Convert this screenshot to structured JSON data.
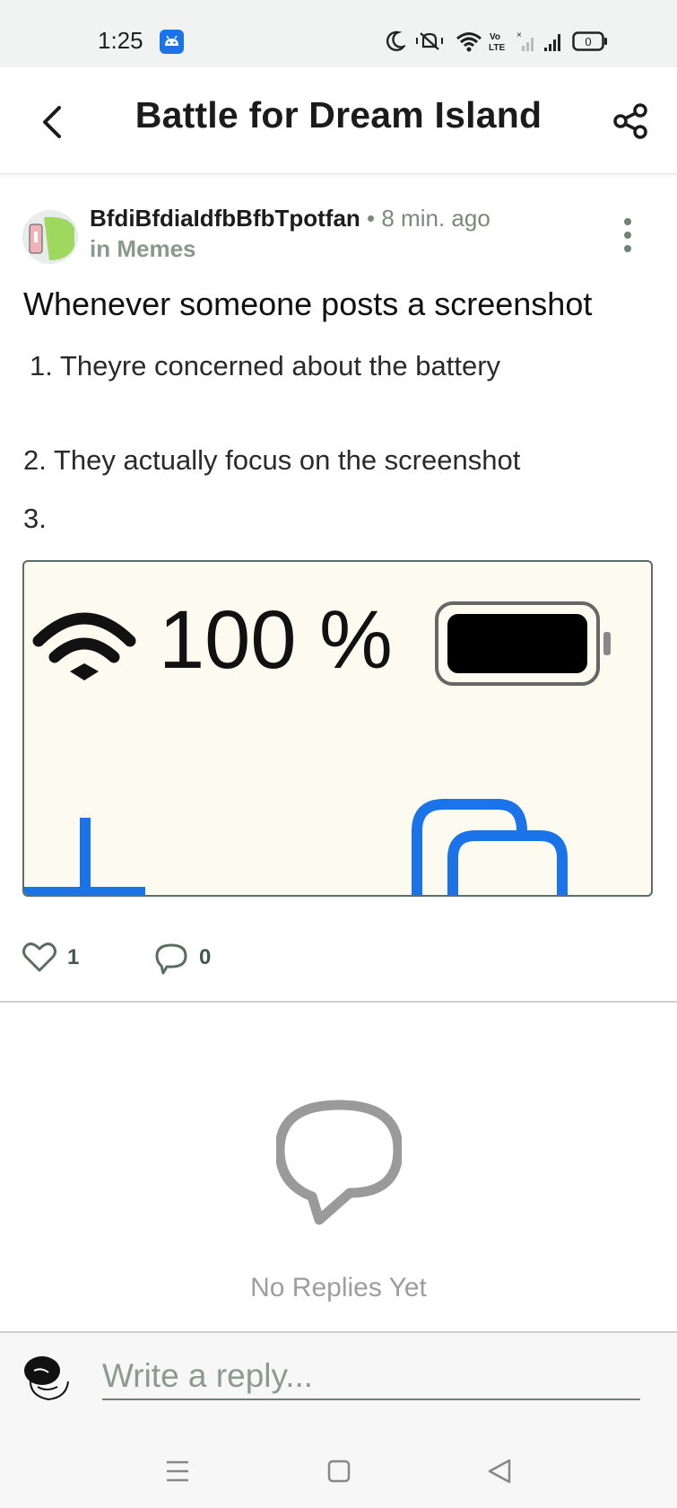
{
  "status_bar": {
    "time": "1:25",
    "icons": [
      "android-notification-icon",
      "moon-icon",
      "vibrate-icon",
      "wifi-icon",
      "volte-icon",
      "signal-x-icon",
      "signal-icon",
      "battery-icon"
    ],
    "battery_text": "0"
  },
  "header": {
    "title": "Battle for Dream Island"
  },
  "post": {
    "author": "BfdiBfdiaIdfbBfbTpotfan",
    "time_ago": "8 min. ago",
    "community": "in Memes",
    "title": "Whenever someone posts a screenshot",
    "line1": "1. Theyre concerned about the battery",
    "line2": "2. They actually focus on the screenshot",
    "line3": "3.",
    "image": {
      "text": "100 %"
    },
    "likes": "1",
    "comments": "0"
  },
  "replies": {
    "empty_text": "No Replies Yet"
  },
  "reply_bar": {
    "placeholder": "Write a reply..."
  },
  "colors": {
    "accent": "#1a73e8",
    "meta_text": "#7a8a7a",
    "community_text": "#889a8a"
  }
}
